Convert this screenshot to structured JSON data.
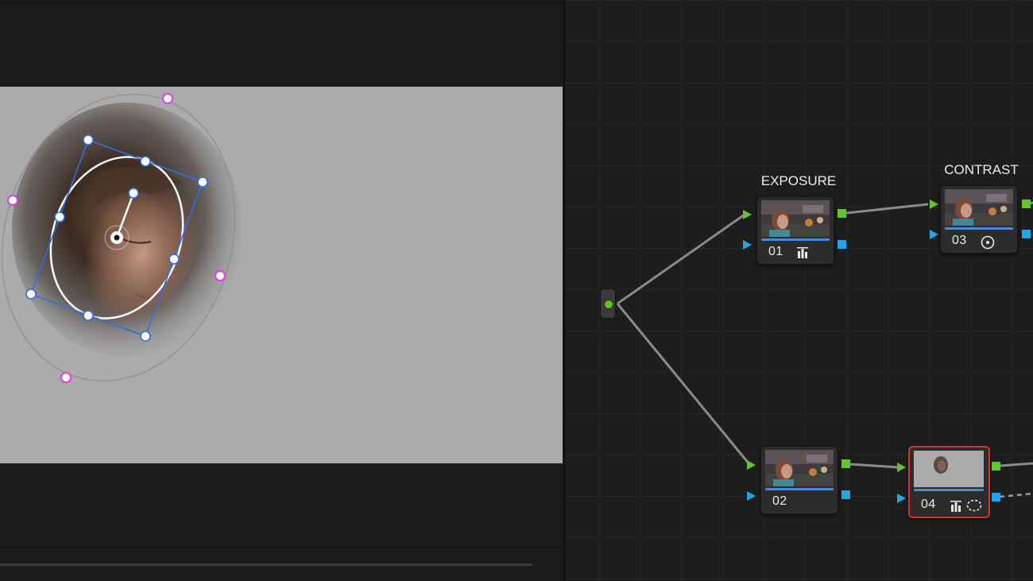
{
  "viewer": {
    "frame_color": "#ababab",
    "bezier_handle_color": "#2f6fe0",
    "softness_handle_color": "#e23ce8"
  },
  "node_editor": {
    "nodes": [
      {
        "number": "01",
        "label": "EXPOSURE",
        "icons": [
          "bars-icon"
        ]
      },
      {
        "number": "02",
        "label": "",
        "icons": []
      },
      {
        "number": "03",
        "label": "CONTRAST",
        "icons": [
          "circle-dot-icon"
        ]
      },
      {
        "number": "04",
        "label": "",
        "icons": [
          "bars-icon",
          "dashed-circle-icon"
        ],
        "selected": true
      }
    ],
    "colors": {
      "rgb_port": "#64c42b",
      "key_port": "#1fa6e8",
      "selected_border": "#d8322e",
      "wire": "#8a8a8a"
    }
  }
}
